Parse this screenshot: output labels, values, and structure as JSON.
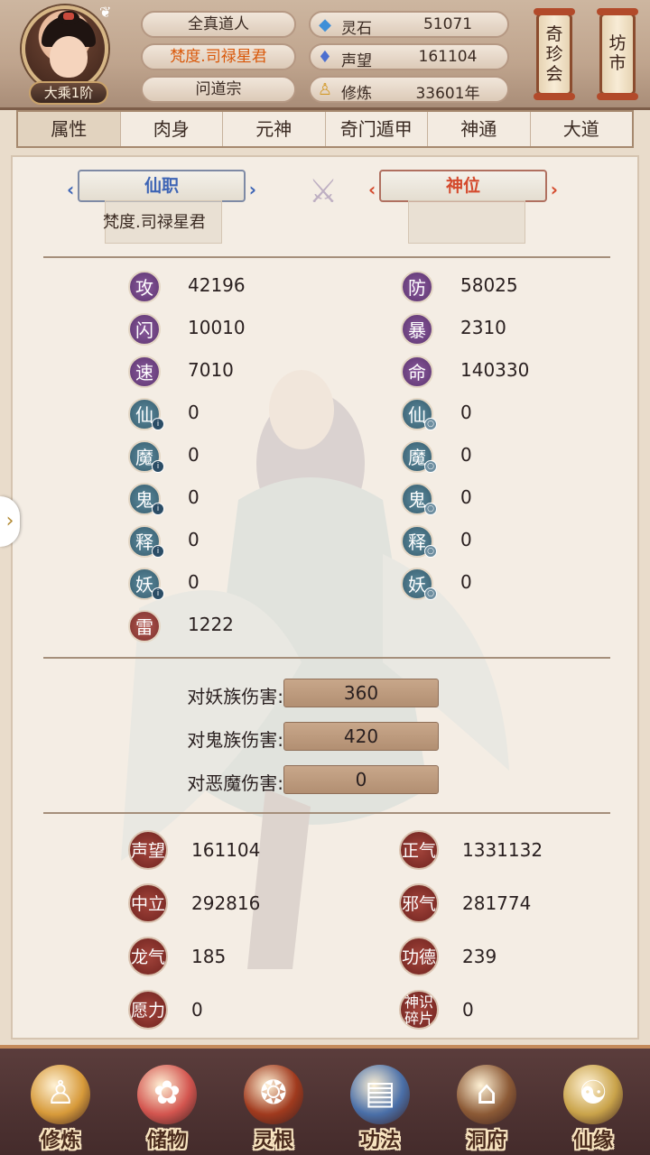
{
  "header": {
    "rank": "大乘1阶",
    "names": [
      "全真道人",
      "梵度.司禄星君",
      "问道宗"
    ],
    "resources": [
      {
        "icon": "spirit-stone-icon",
        "label": "灵石",
        "value": "51071"
      },
      {
        "icon": "prestige-flame-icon",
        "label": "声望",
        "value": "161104"
      },
      {
        "icon": "meditation-icon",
        "label": "修炼",
        "value": "33601年"
      }
    ],
    "shortcuts": [
      {
        "label": "奇珍会"
      },
      {
        "label": "坊市"
      }
    ]
  },
  "tabs": [
    {
      "label": "属性",
      "active": true
    },
    {
      "label": "肉身"
    },
    {
      "label": "元神"
    },
    {
      "label": "奇门遁甲"
    },
    {
      "label": "神通"
    },
    {
      "label": "大道"
    }
  ],
  "position": {
    "xianzhi_title": "仙职",
    "xianzhi_value": "梵度.司禄星君",
    "shenwei_title": "神位"
  },
  "stats_left": [
    {
      "char": "攻",
      "value": "42196",
      "style": "purple"
    },
    {
      "char": "闪",
      "value": "10010",
      "style": "purple"
    },
    {
      "char": "速",
      "value": "7010",
      "style": "purple"
    },
    {
      "char": "仙",
      "value": "0",
      "style": "teal",
      "marker": "i"
    },
    {
      "char": "魔",
      "value": "0",
      "style": "teal",
      "marker": "i"
    },
    {
      "char": "鬼",
      "value": "0",
      "style": "teal",
      "marker": "i"
    },
    {
      "char": "释",
      "value": "0",
      "style": "teal",
      "marker": "i"
    },
    {
      "char": "妖",
      "value": "0",
      "style": "teal",
      "marker": "i"
    },
    {
      "char": "雷",
      "value": "1222",
      "style": "red"
    }
  ],
  "stats_right": [
    {
      "char": "防",
      "value": "58025",
      "style": "purple"
    },
    {
      "char": "暴",
      "value": "2310",
      "style": "purple"
    },
    {
      "char": "命",
      "value": "140330",
      "style": "purple"
    },
    {
      "char": "仙",
      "value": "0",
      "style": "teal",
      "marker": "o"
    },
    {
      "char": "魔",
      "value": "0",
      "style": "teal",
      "marker": "o"
    },
    {
      "char": "鬼",
      "value": "0",
      "style": "teal",
      "marker": "o"
    },
    {
      "char": "释",
      "value": "0",
      "style": "teal",
      "marker": "o"
    },
    {
      "char": "妖",
      "value": "0",
      "style": "teal",
      "marker": "o"
    }
  ],
  "damage": [
    {
      "label": "对妖族伤害:",
      "value": "360"
    },
    {
      "label": "对鬼族伤害:",
      "value": "420"
    },
    {
      "label": "对恶魔伤害:",
      "value": "0"
    }
  ],
  "reputation_left": [
    {
      "label": "声望",
      "value": "161104"
    },
    {
      "label": "中立",
      "value": "292816"
    },
    {
      "label": "龙气",
      "value": "185"
    },
    {
      "label": "愿力",
      "value": "0"
    }
  ],
  "reputation_right": [
    {
      "label": "正气",
      "value": "1331132"
    },
    {
      "label": "邪气",
      "value": "281774"
    },
    {
      "label": "功德",
      "value": "239"
    },
    {
      "label": "神识碎片",
      "value": "0",
      "small": true
    }
  ],
  "bottom_nav": [
    {
      "label": "修炼",
      "icon": "meditation-figure-icon",
      "color": "#d79a3a"
    },
    {
      "label": "储物",
      "icon": "storage-bag-icon",
      "color": "#d3554f"
    },
    {
      "label": "灵根",
      "icon": "spirit-root-icon",
      "color": "#a03a1e"
    },
    {
      "label": "功法",
      "icon": "scripture-book-icon",
      "color": "#4a6fa8"
    },
    {
      "label": "洞府",
      "icon": "cave-mansion-icon",
      "color": "#8c5a36"
    },
    {
      "label": "仙缘",
      "icon": "gourd-icon",
      "color": "#c9a34a"
    }
  ]
}
